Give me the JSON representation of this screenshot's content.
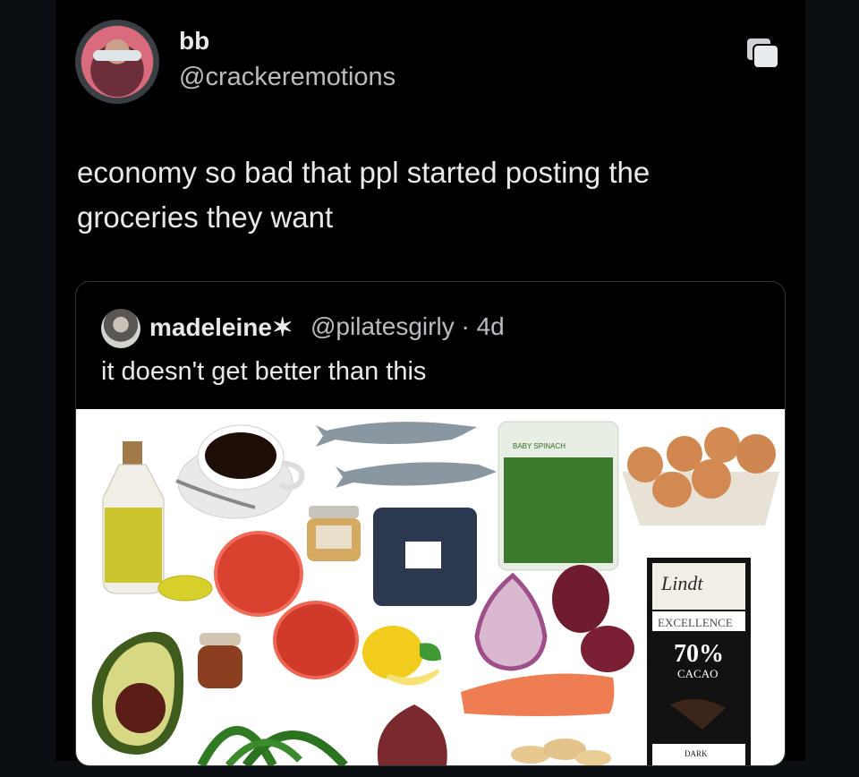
{
  "tweet": {
    "author_name": "bb",
    "author_handle": "@crackeremotions",
    "text": "economy so bad that ppl started posting the groceries they want"
  },
  "quoted_tweet": {
    "author_name": "madeleine✶",
    "author_handle": "@pilatesgirly",
    "separator": "·",
    "age": "4d",
    "text": "it doesn't get better than this"
  },
  "image_labels": {
    "chocolate_brand": "Lindt",
    "chocolate_line": "EXCELLENCE",
    "chocolate_percent": "70%",
    "chocolate_cacao": "CACAO",
    "chocolate_dark": "DARK",
    "spinach_bag": "BABY SPINACH"
  },
  "icons": {
    "copy": "copy-icon"
  }
}
